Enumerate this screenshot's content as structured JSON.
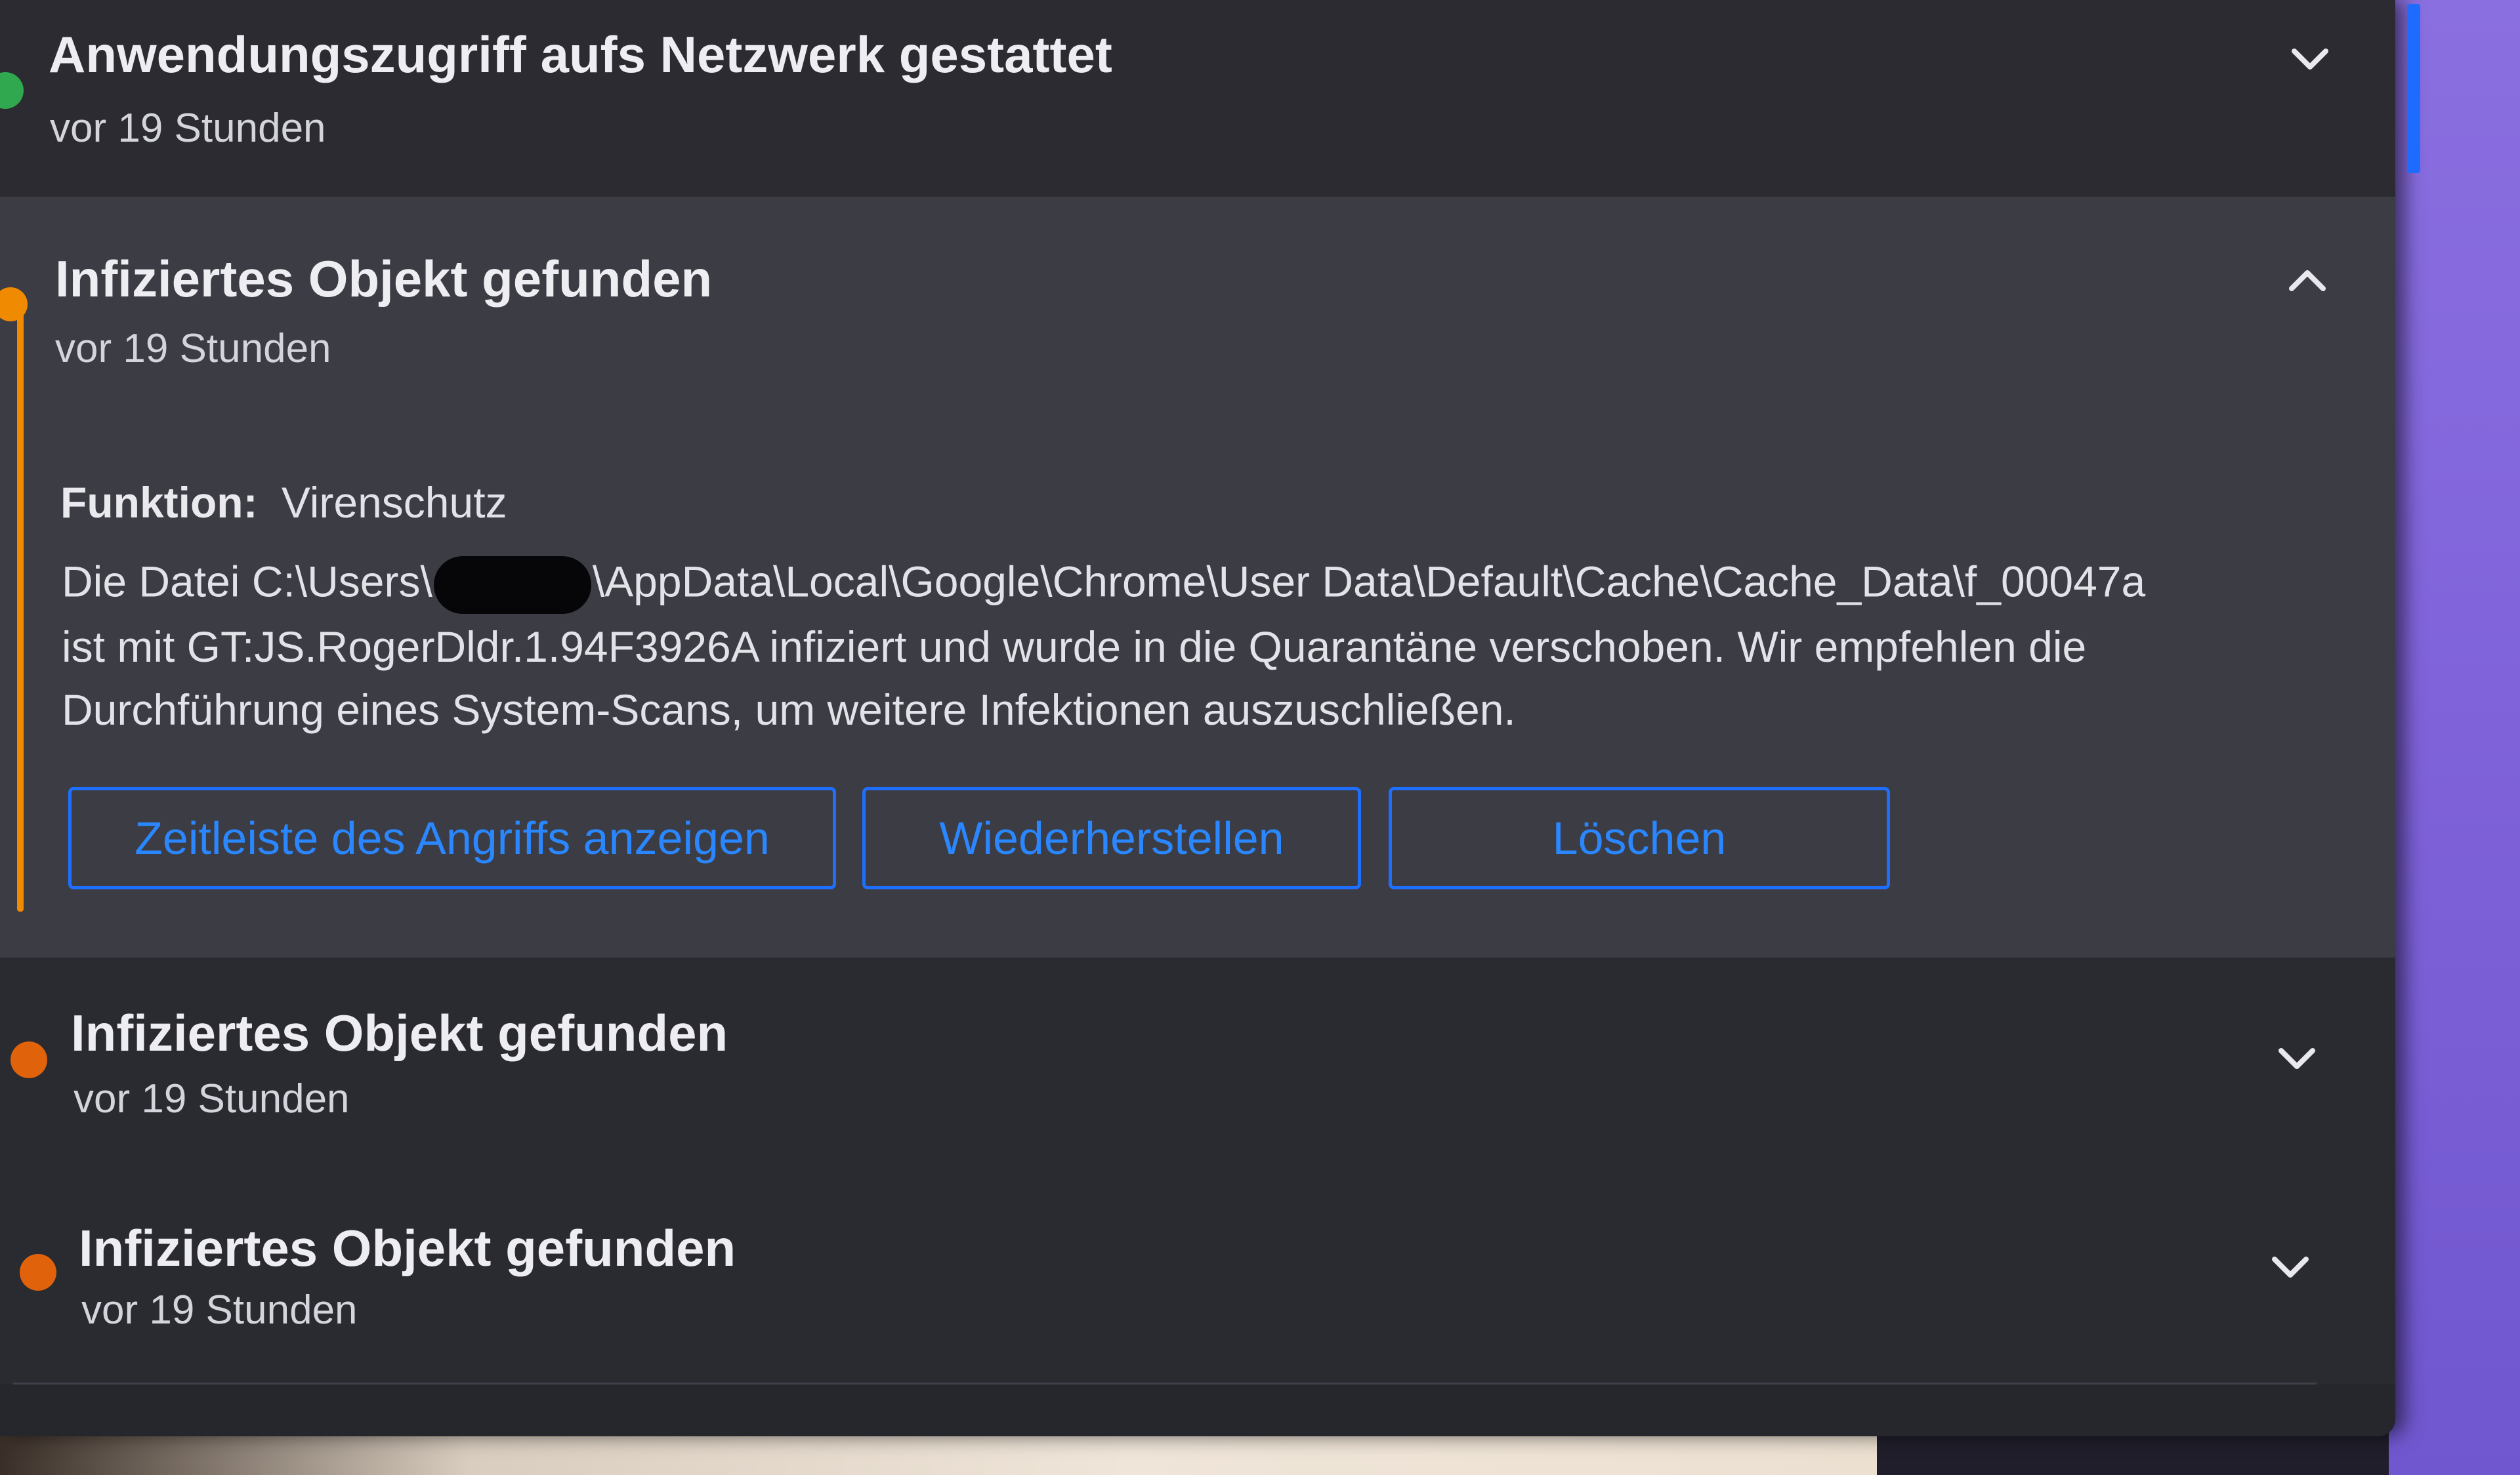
{
  "colors": {
    "accent_blue": "#1f6fff",
    "warning_orange": "#e0620a",
    "allowed_green": "#2fa84f"
  },
  "events": [
    {
      "title": "Anwendungszugriff aufs Netzwerk gestattet",
      "time": "vor 19 Stunden",
      "status": "allowed",
      "expanded": false
    },
    {
      "title": "Infiziertes Objekt gefunden",
      "time": "vor 19 Stunden",
      "status": "infected",
      "expanded": true,
      "detail": {
        "function_label": "Funktion:",
        "function_value": "Virenschutz",
        "message_line1_start": "Die Datei C:\\Users\\",
        "message_line1_end": "\\AppData\\Local\\Google\\Chrome\\User Data\\Default\\Cache\\Cache_Data\\f_00047a",
        "message_line2": "ist mit GT:JS.RogerDldr.1.94F3926A infiziert und wurde in die Quarantäne verschoben. Wir empfehlen die",
        "message_line3": "Durchführung eines System-Scans, um weitere Infektionen auszuschließen."
      },
      "actions": {
        "timeline": "Zeitleiste des Angriffs anzeigen",
        "restore": "Wiederherstellen",
        "delete": "Löschen"
      }
    },
    {
      "title": "Infiziertes Objekt gefunden",
      "time": "vor 19 Stunden",
      "status": "infected",
      "expanded": false
    },
    {
      "title": "Infiziertes Objekt gefunden",
      "time": "vor 19 Stunden",
      "status": "infected",
      "expanded": false
    }
  ]
}
